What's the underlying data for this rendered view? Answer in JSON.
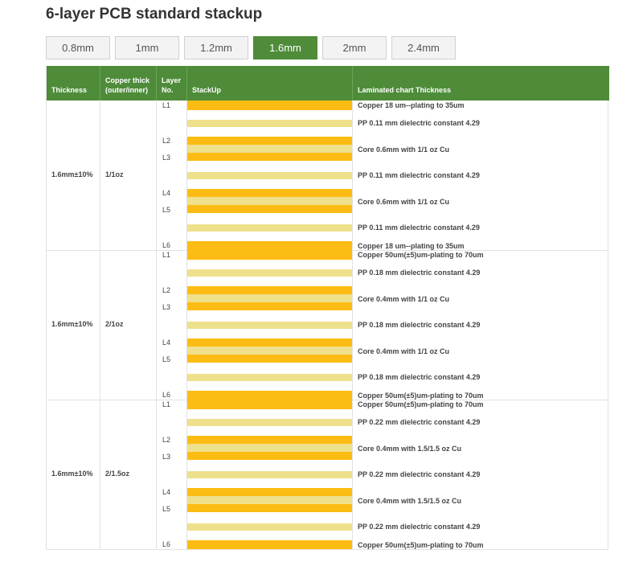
{
  "title": "6-layer PCB standard stackup",
  "tabs": [
    "0.8mm",
    "1mm",
    "1.2mm",
    "1.6mm",
    "2mm",
    "2.4mm"
  ],
  "active_tab": "1.6mm",
  "headers": {
    "thickness": "Thickness",
    "copper": [
      "Copper thick",
      "(outer/inner)"
    ],
    "layer": [
      "Layer",
      "No."
    ],
    "stackup": "StackUp",
    "laminated": "Laminated chart Thickness"
  },
  "colors": {
    "header": "#4e8c3a",
    "copper_bar": "#fdbc13",
    "prepreg_bar": "#efe08c"
  },
  "groups": [
    {
      "thickness": "1.6mm±10%",
      "copper": "1/1oz",
      "layers": [
        "L1",
        "L2",
        "L3",
        "L4",
        "L5",
        "L6"
      ],
      "labels": [
        "Copper 18 um--plating to 35um",
        "PP 0.11 mm dielectric constant 4.29",
        "Core 0.6mm with 1/1 oz Cu",
        "PP 0.11 mm dielectric constant 4.29",
        "Core 0.6mm with 1/1 oz Cu",
        "PP 0.11 mm dielectric constant 4.29",
        "Copper 18 um--plating to 35um"
      ]
    },
    {
      "thickness": "1.6mm±10%",
      "copper": "2/1oz",
      "layers": [
        "L1",
        "L2",
        "L3",
        "L4",
        "L5",
        "L6"
      ],
      "labels": [
        "Copper 50um(±5)um-plating to 70um",
        "PP 0.18 mm dielectric constant 4.29",
        "Core 0.4mm with 1/1 oz Cu",
        "PP 0.18 mm dielectric constant 4.29",
        "Core 0.4mm with 1/1 oz Cu",
        "PP 0.18 mm dielectric constant 4.29",
        "Copper 50um(±5)um-plating to 70um"
      ]
    },
    {
      "thickness": "1.6mm±10%",
      "copper": "2/1.5oz",
      "layers": [
        "L1",
        "L2",
        "L3",
        "L4",
        "L5",
        "L6"
      ],
      "labels": [
        "Copper 50um(±5)um-plating to 70um",
        "PP 0.22 mm dielectric constant 4.29",
        "Core 0.4mm with 1.5/1.5 oz Cu",
        "PP 0.22 mm dielectric constant 4.29",
        "Core 0.4mm with 1.5/1.5 oz Cu",
        "PP 0.22 mm dielectric constant 4.29",
        "Copper 50um(±5)um-plating to 70um"
      ]
    }
  ]
}
